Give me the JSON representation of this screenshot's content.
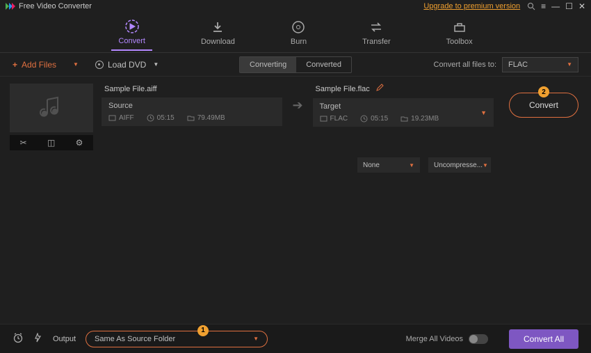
{
  "app": {
    "title": "Free Video Converter",
    "upgrade_text": "Upgrade to premium version"
  },
  "tabs": {
    "convert": "Convert",
    "download": "Download",
    "burn": "Burn",
    "transfer": "Transfer",
    "toolbox": "Toolbox"
  },
  "toolbar": {
    "add_files": "Add Files",
    "load_dvd": "Load DVD",
    "converting": "Converting",
    "converted": "Converted",
    "convert_all_to": "Convert all files to:",
    "format": "FLAC"
  },
  "file": {
    "source_name": "Sample File.aiff",
    "target_name": "Sample File.flac",
    "source": {
      "title": "Source",
      "format": "AIFF",
      "duration": "05:15",
      "size": "79.49MB"
    },
    "target": {
      "title": "Target",
      "format": "FLAC",
      "duration": "05:15",
      "size": "19.23MB"
    },
    "convert_btn": "Convert",
    "badge2": "2",
    "sub1": "None",
    "sub2": "Uncompresse..."
  },
  "footer": {
    "output_label": "Output",
    "output_value": "Same As Source Folder",
    "badge1": "1",
    "merge_label": "Merge All Videos",
    "convert_all": "Convert All"
  }
}
